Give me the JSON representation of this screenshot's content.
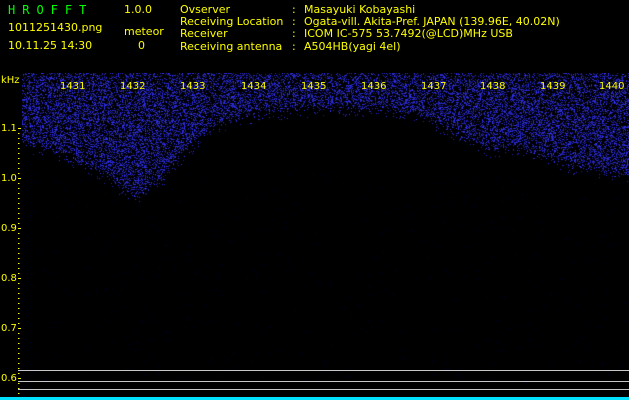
{
  "header": {
    "app_title": "HROFFT",
    "version": "1.0.0",
    "filename": "1011251430.png",
    "datetime": "10.11.25 14:30",
    "meteor_label": "meteor",
    "meteor_count": "0"
  },
  "info": {
    "rows": [
      {
        "key": "Ovserver",
        "sep": ":",
        "value": "Masayuki Kobayashi"
      },
      {
        "key": "Receiving Location",
        "sep": ":",
        "value": "Ogata-vill. Akita-Pref. JAPAN (139.96E, 40.02N)"
      },
      {
        "key": "Receiver",
        "sep": ":",
        "value": "ICOM IC-575 53.7492(@LCD)MHz USB"
      },
      {
        "key": "Receiving antenna",
        "sep": ":",
        "value": "A504HB(yagi 4el)"
      }
    ]
  },
  "axes": {
    "unit": "kHz",
    "x_ticks": [
      "1431",
      "1432",
      "1433",
      "1434",
      "1435",
      "1436",
      "1437",
      "1438",
      "1439",
      "1440"
    ],
    "y_ticks": [
      "1.1",
      "1.0",
      "0.9",
      "0.8",
      "0.7",
      "0.6"
    ]
  },
  "colors": {
    "text": "#ffff00",
    "title": "#00ff00",
    "signal": "#3030ff",
    "background": "#000000",
    "bottom_bar": "#00e0ff"
  }
}
